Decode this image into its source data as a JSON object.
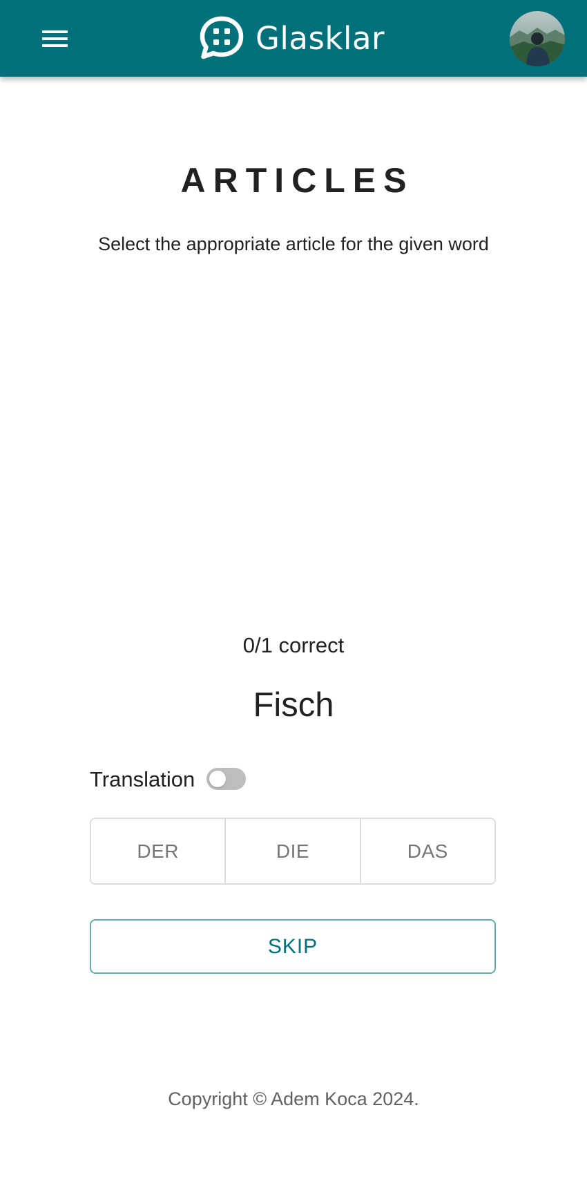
{
  "colors": {
    "primary": "#00707a",
    "text": "#212121",
    "muted": "#757575",
    "footer": "#616161",
    "border": "#dcdcdc",
    "switch_off": "#bdbdbd"
  },
  "header": {
    "menu_icon": "hamburger-menu-icon",
    "logo_icon": "chat-bubble-icon",
    "brand_name": "Glasklar",
    "avatar": "user-avatar"
  },
  "main": {
    "title": "ARTICLES",
    "subtitle": "Select the appropriate article for the given word",
    "score_text": "0/1 correct",
    "word": "Fisch",
    "translation_label": "Translation",
    "translation_enabled": false,
    "articles": [
      "DER",
      "DIE",
      "DAS"
    ],
    "skip_label": "SKIP"
  },
  "footer": {
    "copyright": "Copyright © Adem Koca 2024."
  }
}
